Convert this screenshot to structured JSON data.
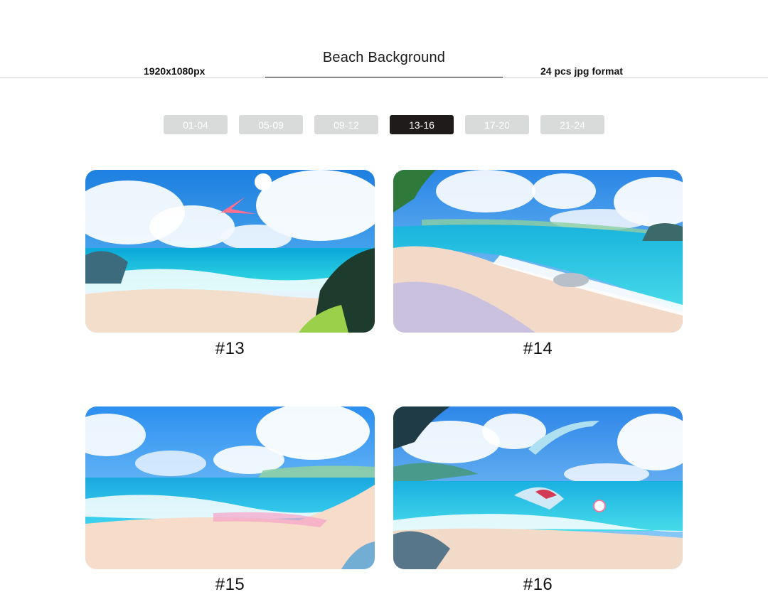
{
  "header": {
    "title": "Beach Background",
    "resolution": "1920x1080px",
    "format": "24 pcs jpg format"
  },
  "tabs": [
    {
      "label": "01-04",
      "active": false
    },
    {
      "label": "05-09",
      "active": false
    },
    {
      "label": "09-12",
      "active": false
    },
    {
      "label": "13-16",
      "active": true
    },
    {
      "label": "17-20",
      "active": false
    },
    {
      "label": "21-24",
      "active": false
    }
  ],
  "gallery": [
    {
      "label": "#13"
    },
    {
      "label": "#14"
    },
    {
      "label": "#15"
    },
    {
      "label": "#16"
    }
  ],
  "colors": {
    "active_tab": "#1f1b1b",
    "inactive_tab": "#d9dada",
    "sky": "#2f8fe8",
    "sea": "#22c3e0",
    "sand": "#f6d9c2"
  }
}
